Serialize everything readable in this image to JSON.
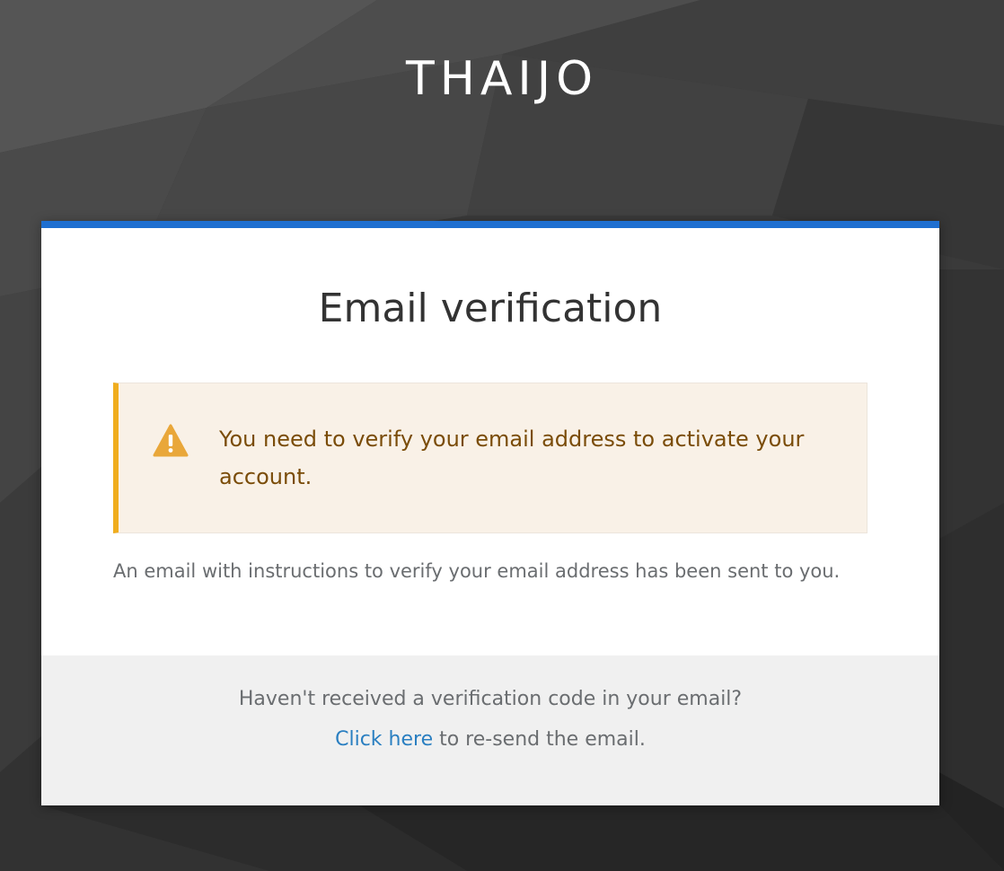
{
  "brand": {
    "name": "THAIJO"
  },
  "card": {
    "title": "Email verification",
    "alert": {
      "icon": "warning-triangle-icon",
      "message": "You need to verify your email address to activate your account."
    },
    "info": "An email with instructions to verify your email address has been sent to you.",
    "footer": {
      "question": "Haven't received a verification code in your email?",
      "link_label": "Click here",
      "after_link": " to re-send the email."
    }
  },
  "colors": {
    "accent_bar": "#1f6fd0",
    "warning_border": "#f0ad1e",
    "warning_bg": "#f9f1e7",
    "warning_text": "#7a4c08",
    "link": "#2a7fc1",
    "footer_bg": "#f0f0f0"
  }
}
